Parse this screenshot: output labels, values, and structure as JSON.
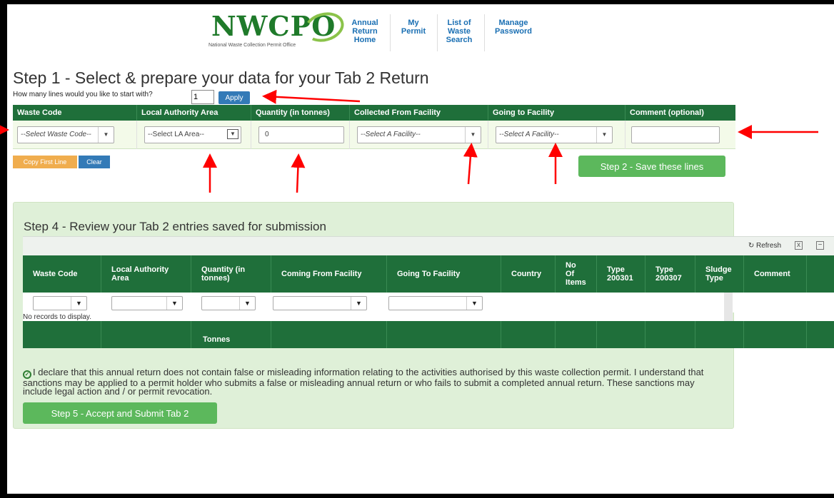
{
  "header": {
    "logo_text": "NWCPO",
    "logo_subtitle": "National Waste Collection Permit Office",
    "nav": [
      {
        "lines": [
          "Annual",
          "Return",
          "Home"
        ]
      },
      {
        "lines": [
          "My",
          "Permit"
        ]
      },
      {
        "lines": [
          "List of",
          "Waste",
          "Search"
        ]
      },
      {
        "lines": [
          "Manage",
          "Password"
        ]
      }
    ]
  },
  "step1": {
    "title": "Step 1 -  Select & prepare your data for your Tab 2 Return",
    "lines_label": "How many lines would you like to start with?",
    "lines_value": "1",
    "apply_label": "Apply",
    "columns": [
      "Waste Code",
      "Local Authority Area",
      "Quantity (in tonnes)",
      "Collected From Facility",
      "Going to Facility",
      "Comment (optional)"
    ],
    "row": {
      "waste_code": "--Select Waste Code--",
      "la_area": "--Select LA Area--",
      "quantity": "0",
      "collected_from": "--Select A Facility--",
      "going_to": "--Select A Facility--",
      "comment": ""
    },
    "copy_first_line_label": "Copy First Line",
    "clear_label": "Clear",
    "step2_label": "Step 2 - Save these lines"
  },
  "step4": {
    "title": "Step 4 - Review your Tab 2 entries saved for submission",
    "refresh_label": "Refresh",
    "columns": [
      [
        "Waste Code"
      ],
      [
        "Local Authority",
        "Area"
      ],
      [
        "Quantity (in",
        "tonnes)"
      ],
      [
        "Coming From Facility"
      ],
      [
        "Going To Facility"
      ],
      [
        "Country"
      ],
      [
        "No",
        "Of",
        "Items"
      ],
      [
        "Type",
        "200301"
      ],
      [
        "Type",
        "200307"
      ],
      [
        "Sludge",
        "Type"
      ],
      [
        "Comment"
      ]
    ],
    "no_records": "No records to display.",
    "footer_tonnes": "Tonnes"
  },
  "declaration": {
    "text": "I declare that this annual return does not contain false or misleading information relating to the activities authorised by this waste collection permit. I understand that sanctions may be applied to a permit holder who submits a false or misleading annual return or who fails to submit a completed annual return. These sanctions may include legal action and / or permit revocation."
  },
  "step5_label": "Step 5 - Accept and Submit Tab 2",
  "accent_colors": {
    "table_header": "#1f6f3a",
    "primary_button": "#337ab7",
    "success_button": "#5cb85c",
    "warning_button": "#f0ad4e",
    "annotation_arrow": "#ff0000"
  }
}
